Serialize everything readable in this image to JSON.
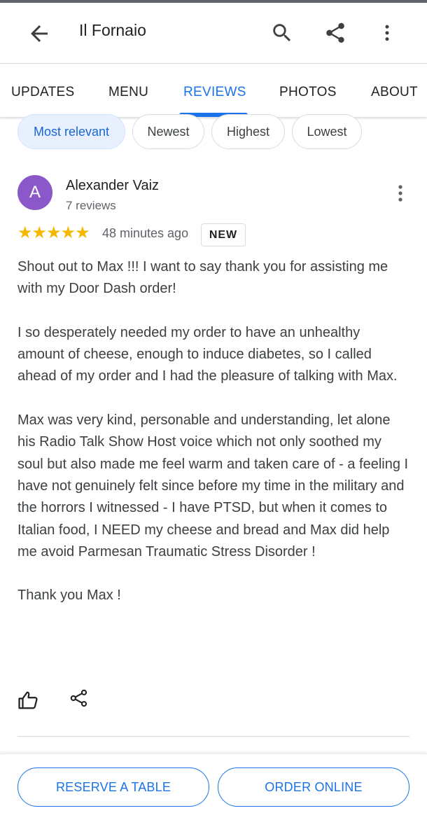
{
  "app": {
    "title": "Il Fornaio"
  },
  "tabs": [
    {
      "label": "UPDATES"
    },
    {
      "label": "MENU"
    },
    {
      "label": "REVIEWS",
      "active": true
    },
    {
      "label": "PHOTOS"
    },
    {
      "label": "ABOUT"
    }
  ],
  "sort_chips": [
    {
      "label": "Most relevant",
      "selected": true
    },
    {
      "label": "Newest"
    },
    {
      "label": "Highest"
    },
    {
      "label": "Lowest"
    }
  ],
  "review": {
    "avatar_initial": "A",
    "avatar_color": "#8a58c8",
    "reviewer_name": "Alexander Vaiz",
    "review_count": "7 reviews",
    "rating": 5,
    "stars": "★★★★★",
    "time_ago": "48 minutes ago",
    "badge": "NEW",
    "paragraphs": [
      "Shout out to Max !!! I want to say thank you for assisting me with my Door Dash order!",
      "I so desperately needed my order to have an unhealthy amount of cheese, enough to induce diabetes, so I called ahead of my order and I had the pleasure of talking with Max.",
      "Max was very kind, personable and understanding, let alone his Radio Talk Show Host voice which not only soothed my soul but also made me feel warm and taken care of - a feeling I have not genuinely felt since before my time in the military and the horrors I witnessed - I have PTSD, but when it comes to Italian food, I NEED my cheese and bread and Max did help me avoid Parmesan Traumatic Stress Disorder !",
      "Thank you Max !"
    ]
  },
  "actions": {
    "reserve_label": "RESERVE A TABLE",
    "order_label": "ORDER ONLINE"
  },
  "colors": {
    "accent": "#1a73e8",
    "star": "#f5b800",
    "chip_selected_bg": "#e8f0fe"
  },
  "icons": [
    "back-arrow-icon",
    "search-icon",
    "share-icon",
    "more-vert-icon",
    "thumbs-up-icon",
    "share-icon"
  ]
}
